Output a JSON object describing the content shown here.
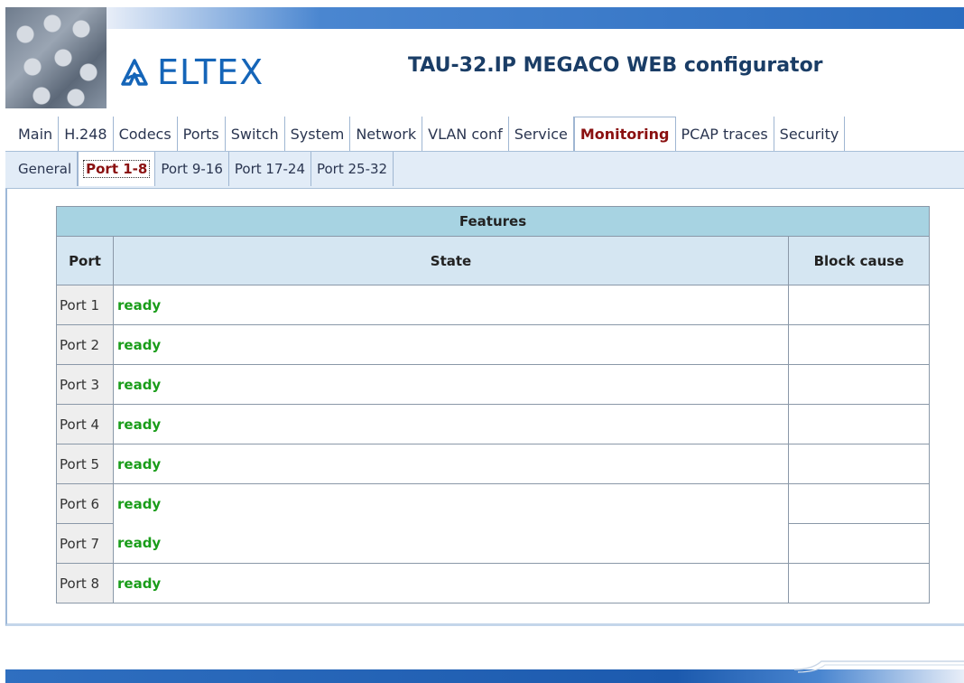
{
  "header": {
    "logo_text": "ELTEX",
    "title": "TAU-32.IP MEGACO WEB configurator"
  },
  "main_tabs": [
    {
      "label": "Main",
      "active": false
    },
    {
      "label": "H.248",
      "active": false
    },
    {
      "label": "Codecs",
      "active": false
    },
    {
      "label": "Ports",
      "active": false
    },
    {
      "label": "Switch",
      "active": false
    },
    {
      "label": "System",
      "active": false
    },
    {
      "label": "Network",
      "active": false
    },
    {
      "label": "VLAN conf",
      "active": false
    },
    {
      "label": "Service",
      "active": false
    },
    {
      "label": "Monitoring",
      "active": true
    },
    {
      "label": "PCAP traces",
      "active": false
    },
    {
      "label": "Security",
      "active": false
    }
  ],
  "sub_tabs": [
    {
      "label": "General",
      "active": false
    },
    {
      "label": "Port 1-8",
      "active": true
    },
    {
      "label": "Port 9-16",
      "active": false
    },
    {
      "label": "Port 17-24",
      "active": false
    },
    {
      "label": "Port 25-32",
      "active": false
    }
  ],
  "table": {
    "caption": "Features",
    "headers": {
      "port": "Port",
      "state": "State",
      "block_cause": "Block cause"
    },
    "rows": [
      {
        "port": "Port 1",
        "state": "ready",
        "block_cause": ""
      },
      {
        "port": "Port 2",
        "state": "ready",
        "block_cause": ""
      },
      {
        "port": "Port 3",
        "state": "ready",
        "block_cause": ""
      },
      {
        "port": "Port 4",
        "state": "ready",
        "block_cause": ""
      },
      {
        "port": "Port 5",
        "state": "ready",
        "block_cause": ""
      },
      {
        "port": "Port 6",
        "state": "ready",
        "block_cause": ""
      },
      {
        "port": "Port 7",
        "state": "ready",
        "block_cause": ""
      },
      {
        "port": "Port 8",
        "state": "ready",
        "block_cause": ""
      }
    ]
  },
  "colors": {
    "brand_blue": "#1565b8",
    "active_tab_text": "#8a1010",
    "state_ready": "#1a9d1a",
    "caption_bg": "#a7d3e2",
    "header_bg": "#d5e6f2"
  },
  "icons": {
    "logo": "eltex-logo-icon"
  }
}
